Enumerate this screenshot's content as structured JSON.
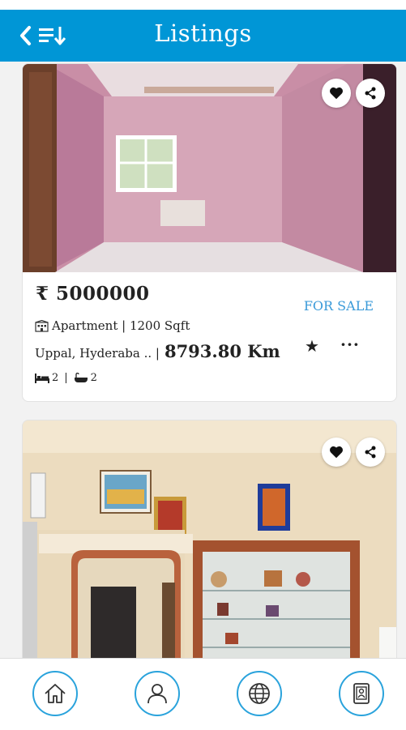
{
  "header": {
    "title": "Listings",
    "back_icon": "chevron-left-icon",
    "sort_icon": "sort-icon"
  },
  "listings": [
    {
      "price": "₹ 5000000",
      "status": "FOR SALE",
      "type_line": "Apartment | 1200 Sqft",
      "location": "Uppal, Hyderaba .. |",
      "distance": "8793.80 Km",
      "beds": "2",
      "baths": "2",
      "separator": "|",
      "star": "★",
      "more": "···"
    },
    {
      "photo": "living-room-with-showcase"
    }
  ],
  "bottom_nav": [
    {
      "icon": "home-icon"
    },
    {
      "icon": "user-icon"
    },
    {
      "icon": "globe-icon"
    },
    {
      "icon": "contact-card-icon"
    }
  ],
  "colors": {
    "appbar": "#0096d6",
    "accent": "#2aa3dc",
    "for_sale": "#3a9ad9"
  }
}
